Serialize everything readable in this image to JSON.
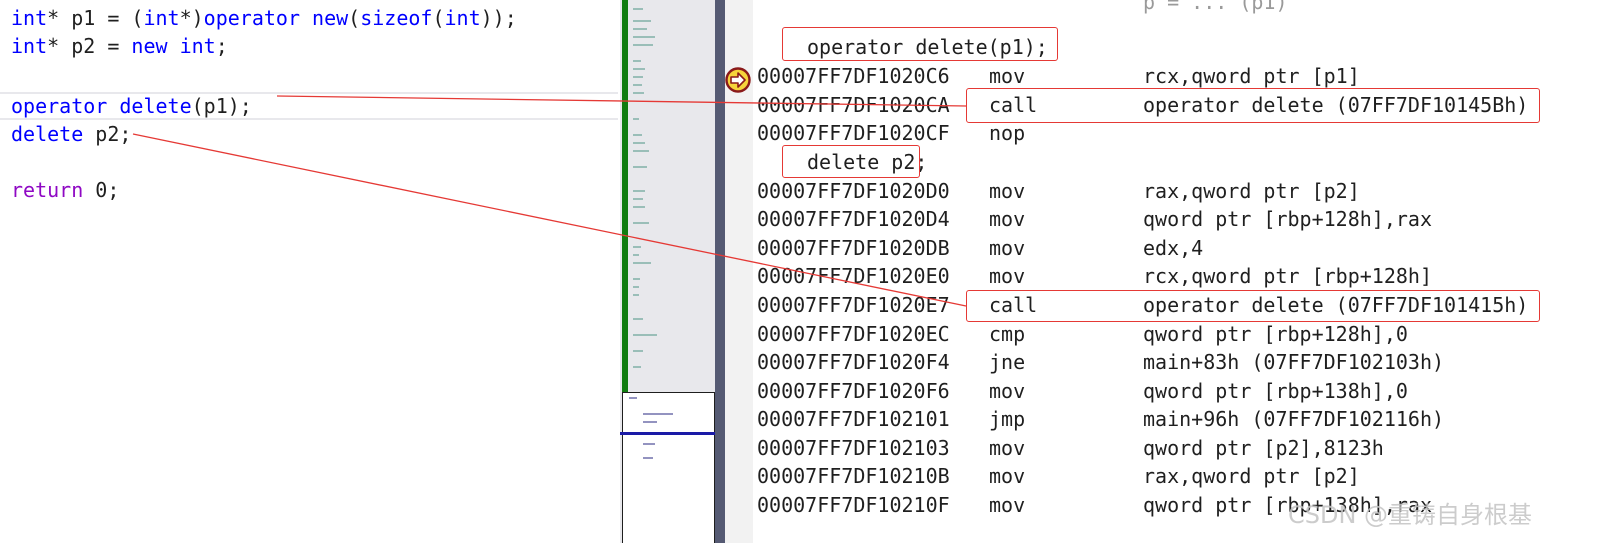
{
  "source": {
    "lines": [
      {
        "t1": "int",
        "t2": "* p1 = (",
        "t3": "int",
        "t4": "*)",
        "t5": "operator new",
        "t6": "(",
        "t7": "sizeof",
        "t8": "(",
        "t9": "int",
        "t10": "));"
      },
      {
        "t1": "int",
        "t2": "* p2 = ",
        "t3": "new",
        "t4": " ",
        "t5": "int",
        "t6": ";"
      },
      {
        "t1": "operator delete",
        "t2": "(p1);"
      },
      {
        "t1": "delete",
        "t2": " p2;"
      },
      {
        "t1": "return",
        "t2": " 0;"
      }
    ]
  },
  "disassembly": {
    "top_partial": "p = ... (p1)",
    "source_ref_1": "operator delete(p1);",
    "source_ref_2": "delete p2;",
    "rows": [
      {
        "addr": "00007FF7DF1020C6",
        "mnemonic": "mov",
        "operands": "rcx,qword ptr [p1]"
      },
      {
        "addr": "00007FF7DF1020CA",
        "mnemonic": "call",
        "operands": "operator delete (07FF7DF10145Bh)"
      },
      {
        "addr": "00007FF7DF1020CF",
        "mnemonic": "nop",
        "operands": ""
      },
      {
        "addr": "00007FF7DF1020D0",
        "mnemonic": "mov",
        "operands": "rax,qword ptr [p2]"
      },
      {
        "addr": "00007FF7DF1020D4",
        "mnemonic": "mov",
        "operands": "qword ptr [rbp+128h],rax"
      },
      {
        "addr": "00007FF7DF1020DB",
        "mnemonic": "mov",
        "operands": "edx,4"
      },
      {
        "addr": "00007FF7DF1020E0",
        "mnemonic": "mov",
        "operands": "rcx,qword ptr [rbp+128h]"
      },
      {
        "addr": "00007FF7DF1020E7",
        "mnemonic": "call",
        "operands": "operator delete (07FF7DF101415h)"
      },
      {
        "addr": "00007FF7DF1020EC",
        "mnemonic": "cmp",
        "operands": "qword ptr [rbp+128h],0"
      },
      {
        "addr": "00007FF7DF1020F4",
        "mnemonic": "jne",
        "operands": "main+83h (07FF7DF102103h)"
      },
      {
        "addr": "00007FF7DF1020F6",
        "mnemonic": "mov",
        "operands": "qword ptr [rbp+138h],0"
      },
      {
        "addr": "00007FF7DF102101",
        "mnemonic": "jmp",
        "operands": "main+96h (07FF7DF102116h)"
      },
      {
        "addr": "00007FF7DF102103",
        "mnemonic": "mov",
        "operands": "qword ptr [p2],8123h"
      },
      {
        "addr": "00007FF7DF10210B",
        "mnemonic": "mov",
        "operands": "rax,qword ptr [p2]"
      },
      {
        "addr": "00007FF7DF10210F",
        "mnemonic": "mov",
        "operands": "qword ptr [rbp+138h],rax"
      }
    ]
  },
  "icons": {
    "instruction_pointer": "next-statement-arrow-icon"
  },
  "colors": {
    "annotation": "#e53935",
    "keyword": "#0000ff",
    "control": "#8f08c4",
    "minimap_green": "#107c10"
  },
  "watermark": "CSDN @重铸自身根基"
}
